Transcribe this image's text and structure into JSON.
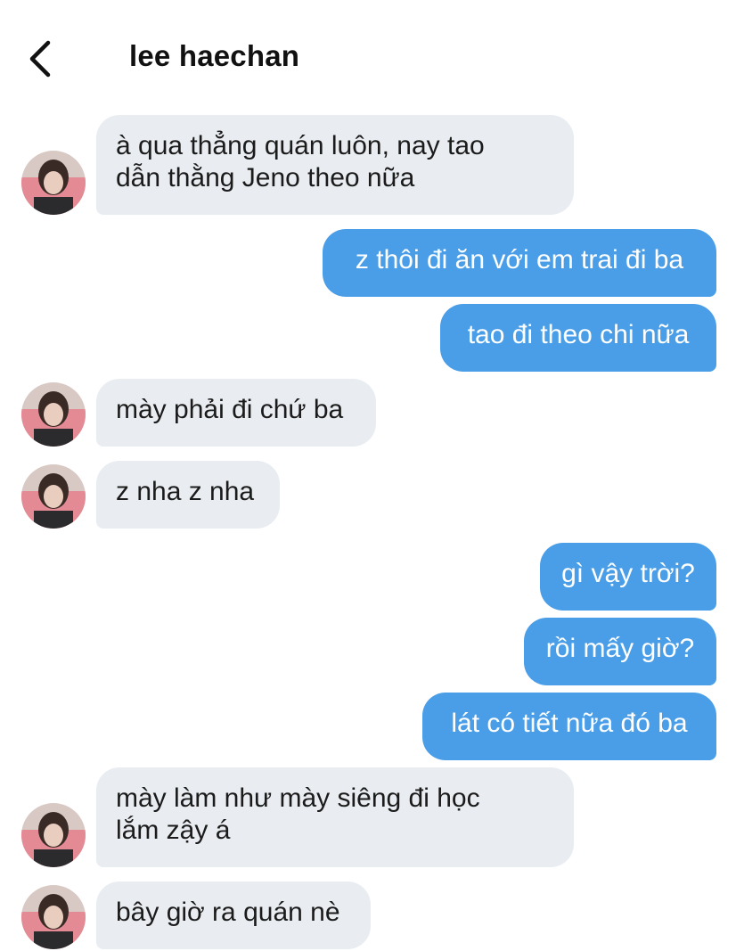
{
  "header": {
    "title": "lee haechan",
    "back_icon": "chevron-left-icon"
  },
  "messages": [
    {
      "side": "in",
      "text": "à qua thẳng quán luôn, nay tao\ndẫn thằng Jeno theo nữa"
    },
    {
      "side": "out",
      "text": "z thôi đi ăn với em trai đi ba"
    },
    {
      "side": "out",
      "text": "tao đi theo chi nữa"
    },
    {
      "side": "in",
      "text": "mày phải đi chứ ba"
    },
    {
      "side": "in",
      "text": "z nha z nha"
    },
    {
      "side": "out",
      "text": "gì vậy trời?"
    },
    {
      "side": "out",
      "text": "rồi mấy giờ?"
    },
    {
      "side": "out",
      "text": "lát có tiết nữa đó ba"
    },
    {
      "side": "in",
      "text": "mày làm như mày siêng đi học\nlắm zậy á"
    },
    {
      "side": "in",
      "text": "bây giờ ra quán nè"
    }
  ],
  "colors": {
    "incoming_bubble": "#e9edf1",
    "outgoing_bubble": "#4a9ee8",
    "outgoing_text": "#ffffff",
    "incoming_text": "#1b1b1b"
  }
}
